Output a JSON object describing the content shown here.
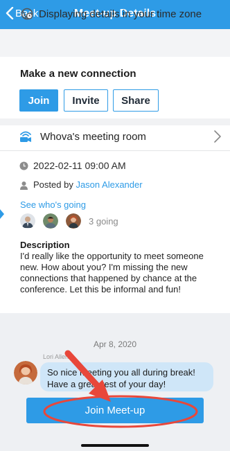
{
  "header": {
    "back_label": "Back",
    "title": "Meet-up Details"
  },
  "timezone": {
    "text": "Displaying details in your time zone",
    "icon": "globe-clock-icon"
  },
  "connection": {
    "title": "Make a new connection",
    "buttons": [
      "Join",
      "Invite",
      "Share"
    ]
  },
  "room": {
    "label": "Whova's meeting room",
    "icon": "video-room-icon"
  },
  "details": {
    "datetime": "2022-02-11 09:00 AM",
    "posted_by_prefix": "Posted by",
    "posted_by_name": "Jason Alexander",
    "see_going": "See who's going",
    "going_count": "3 going"
  },
  "description": {
    "title": "Description",
    "text": "I'd really like the opportunity to meet someone new. How about you? I'm missing the new connections that happened by chance at the conference. Let this be informal and fun!"
  },
  "chat": {
    "date": "Apr 8, 2020",
    "sender": "Lori Allen",
    "message": "So nice meeting you all during break! Have a great rest of your day!"
  },
  "cta": {
    "label": "Join Meet-up"
  },
  "colors": {
    "accent": "#2e9be6",
    "annotation": "#e8473a"
  }
}
